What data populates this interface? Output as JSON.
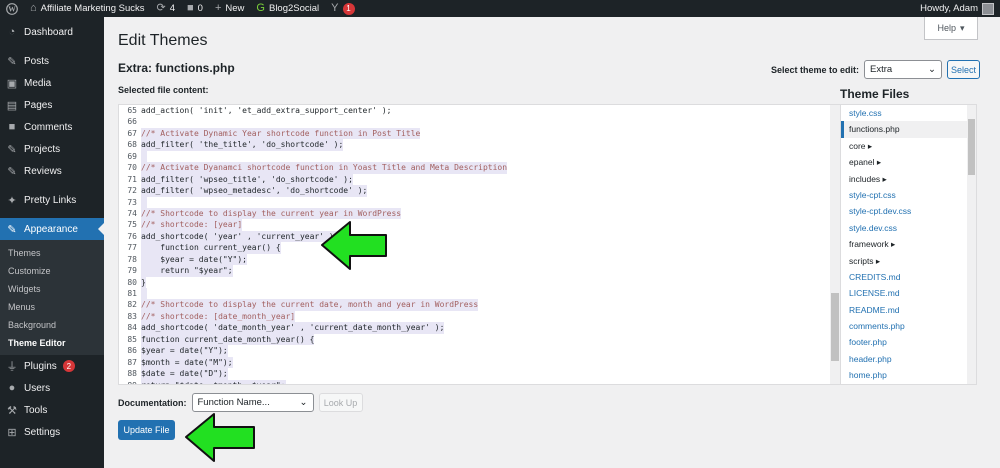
{
  "adminbar": {
    "site_name": "Affiliate Marketing Sucks",
    "updates_count": "4",
    "comments_count": "0",
    "new_label": "New",
    "blog2social_label": "Blog2Social",
    "yoast_badge": "1",
    "howdy": "Howdy, Adam"
  },
  "sidebar": {
    "dashboard": "Dashboard",
    "posts": "Posts",
    "media": "Media",
    "pages": "Pages",
    "comments": "Comments",
    "projects": "Projects",
    "reviews": "Reviews",
    "pretty_links": "Pretty Links",
    "appearance": "Appearance",
    "sub": [
      "Themes",
      "Customize",
      "Widgets",
      "Menus",
      "Background",
      "Theme Editor"
    ],
    "plugins": "Plugins",
    "plugins_badge": "2",
    "users": "Users",
    "tools": "Tools",
    "settings": "Settings"
  },
  "main": {
    "title": "Edit Themes",
    "help": "Help",
    "file_title": "Extra: functions.php",
    "select_theme_label": "Select theme to edit:",
    "selected_theme": "Extra",
    "select_button": "Select",
    "selected_file_label": "Selected file content:"
  },
  "code_lines": [
    {
      "n": "65",
      "t": "add_action( 'init', 'et_add_extra_support_center' );",
      "c": "kw",
      "hl": false
    },
    {
      "n": "66",
      "t": "",
      "c": "kw",
      "hl": false
    },
    {
      "n": "67",
      "t": "//* Activate Dynamic Year shortcode function in Post Title",
      "c": "cmt",
      "hl": true
    },
    {
      "n": "68",
      "t": "add_filter( 'the_title', 'do_shortcode' );",
      "c": "kw",
      "hl": true
    },
    {
      "n": "69",
      "t": "",
      "c": "kw",
      "hl": true
    },
    {
      "n": "70",
      "t": "//* Activate Dyanamci shortcode function in Yoast Title and Meta Description",
      "c": "cmt",
      "hl": true
    },
    {
      "n": "71",
      "t": "add_filter( 'wpseo_title', 'do_shortcode' );",
      "c": "kw",
      "hl": true
    },
    {
      "n": "72",
      "t": "add_filter( 'wpseo_metadesc', 'do_shortcode' );",
      "c": "kw",
      "hl": true
    },
    {
      "n": "73",
      "t": "",
      "c": "kw",
      "hl": true
    },
    {
      "n": "74",
      "t": "//* Shortcode to display the current year in WordPress",
      "c": "cmt",
      "hl": true
    },
    {
      "n": "75",
      "t": "//* shortcode: [year]",
      "c": "cmt",
      "hl": true
    },
    {
      "n": "76",
      "t": "add_shortcode( 'year' , 'current_year' );",
      "c": "kw",
      "hl": true
    },
    {
      "n": "77",
      "t": "    function current_year() {",
      "c": "kw",
      "hl": true
    },
    {
      "n": "78",
      "t": "    $year = date(\"Y\");",
      "c": "kw",
      "hl": true
    },
    {
      "n": "79",
      "t": "    return \"$year\";",
      "c": "kw",
      "hl": true
    },
    {
      "n": "80",
      "t": "}",
      "c": "kw",
      "hl": true
    },
    {
      "n": "81",
      "t": "",
      "c": "kw",
      "hl": true
    },
    {
      "n": "82",
      "t": "//* Shortcode to display the current date, month and year in WordPress",
      "c": "cmt",
      "hl": true
    },
    {
      "n": "83",
      "t": "//* shortcode: [date_month_year]",
      "c": "cmt",
      "hl": true
    },
    {
      "n": "84",
      "t": "add_shortcode( 'date_month_year' , 'current_date_month_year' );",
      "c": "kw",
      "hl": true
    },
    {
      "n": "85",
      "t": "function current_date_month_year() {",
      "c": "kw",
      "hl": true
    },
    {
      "n": "86",
      "t": "$year = date(\"Y\");",
      "c": "kw",
      "hl": true
    },
    {
      "n": "87",
      "t": "$month = date(\"M\");",
      "c": "kw",
      "hl": true
    },
    {
      "n": "88",
      "t": "$date = date(\"D\");",
      "c": "kw",
      "hl": true
    },
    {
      "n": "89",
      "t": "return \"$date, $month, $year\";",
      "c": "kw",
      "hl": true
    }
  ],
  "theme_files": {
    "heading": "Theme Files",
    "items": [
      {
        "name": "style.css",
        "type": "file"
      },
      {
        "name": "functions.php",
        "type": "current"
      },
      {
        "name": "core",
        "type": "folder"
      },
      {
        "name": "epanel",
        "type": "folder"
      },
      {
        "name": "includes",
        "type": "folder"
      },
      {
        "name": "style-cpt.css",
        "type": "file"
      },
      {
        "name": "style-cpt.dev.css",
        "type": "file"
      },
      {
        "name": "style.dev.css",
        "type": "file"
      },
      {
        "name": "framework",
        "type": "folder"
      },
      {
        "name": "scripts",
        "type": "folder"
      },
      {
        "name": "CREDITS.md",
        "type": "file"
      },
      {
        "name": "LICENSE.md",
        "type": "file"
      },
      {
        "name": "README.md",
        "type": "file"
      },
      {
        "name": "comments.php",
        "type": "file"
      },
      {
        "name": "footer.php",
        "type": "file"
      },
      {
        "name": "header.php",
        "type": "file"
      },
      {
        "name": "home.php",
        "type": "file"
      }
    ]
  },
  "documentation": {
    "label": "Documentation:",
    "placeholder": "Function Name...",
    "lookup": "Look Up"
  },
  "update_button": "Update File",
  "colors": {
    "accent": "#2271b1",
    "adminbar": "#1d2327",
    "arrow_green": "#22e021"
  }
}
